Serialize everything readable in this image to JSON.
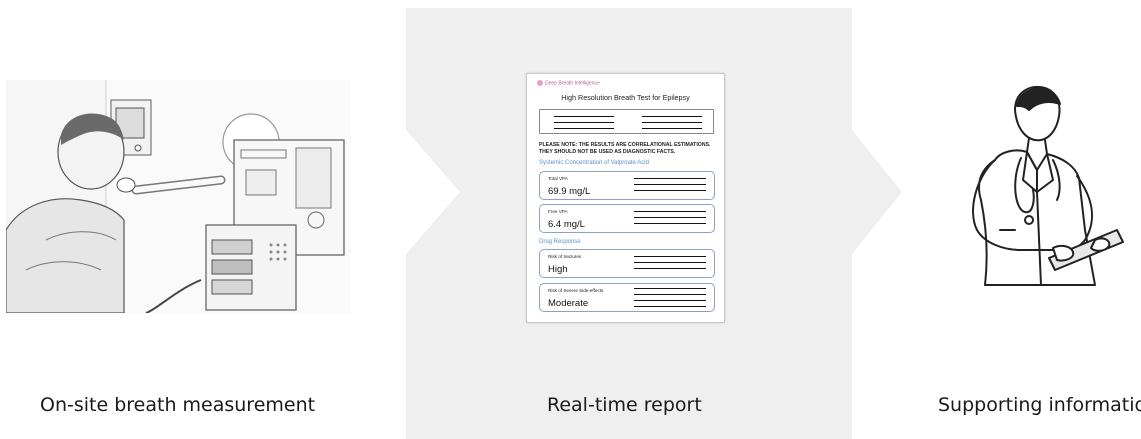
{
  "captions": {
    "left": "On-site breath measurement",
    "middle": "Real-time report",
    "right": "Supporting information"
  },
  "report": {
    "brand": "Deep Breath Intelligence",
    "title": "High Resolution Breath Test for Epilepsy",
    "note": "PLEASE NOTE: THE RESULTS ARE CORRELATIONAL ESTIMATIONS. THEY SHOULD NOT BE USED AS DIAGNOSTIC FACTS.",
    "section1": "Systemic Concentration of Valproate Acid",
    "section2": "Drug Response",
    "boxes": [
      {
        "label": "Total VPA",
        "value": "69.9 mg/L"
      },
      {
        "label": "Free VPA",
        "value": "6.4 mg/L"
      },
      {
        "label": "Risk of Seizures",
        "value": "High"
      },
      {
        "label": "Risk of Severe Side-effects",
        "value": "Moderate"
      }
    ]
  },
  "colors": {
    "panel_bg": "#efefef",
    "accent_blue": "#5a8fd0",
    "brand_pink": "#b8609a"
  }
}
